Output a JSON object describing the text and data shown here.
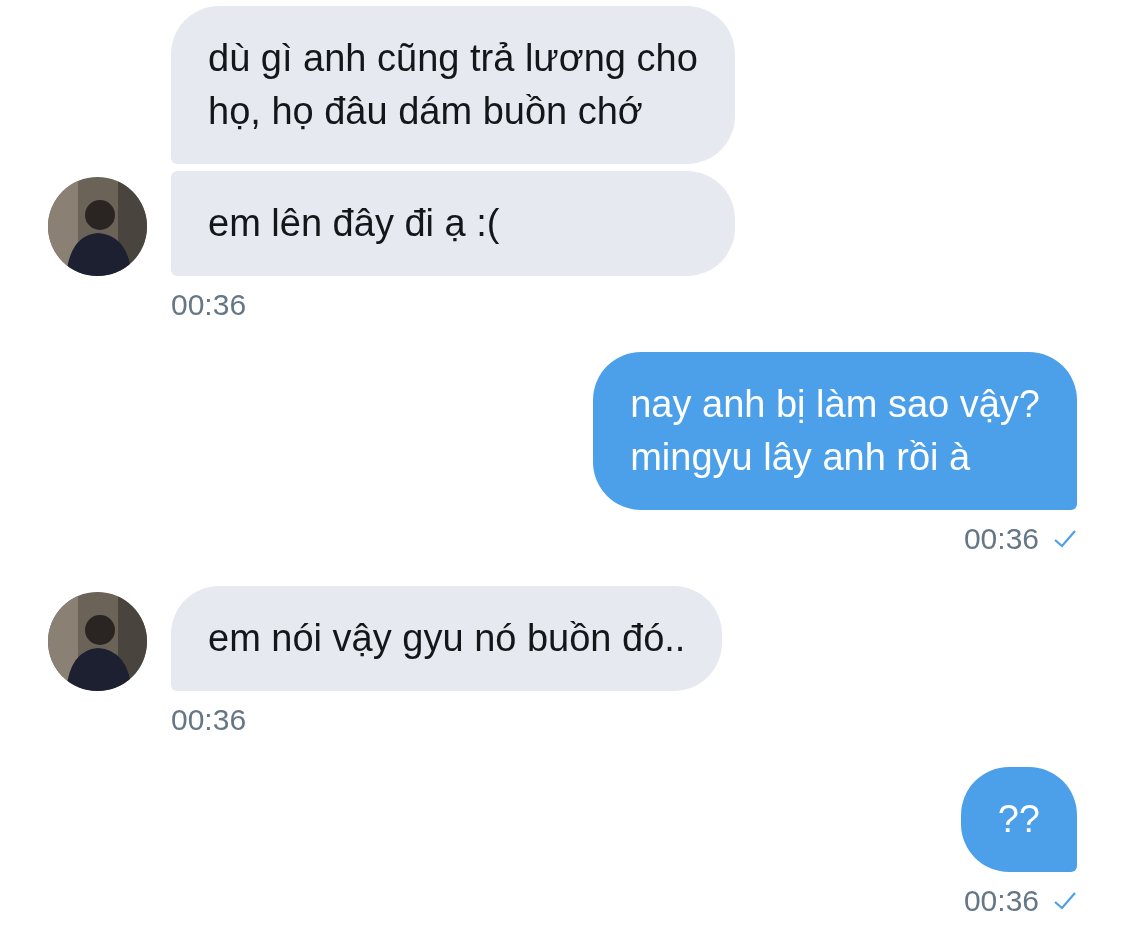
{
  "messages": [
    {
      "kind": "received",
      "bubbles": [
        "dù gì anh cũng trả lương cho\nhọ, họ đâu dám buồn chớ",
        "em lên đây đi ạ :("
      ],
      "time": "00:36"
    },
    {
      "kind": "sent",
      "bubbles": [
        "nay anh bị làm sao vậy?\nmingyu lây anh rồi à"
      ],
      "time": "00:36",
      "delivered": true
    },
    {
      "kind": "received",
      "bubbles": [
        "em nói vậy gyu nó buồn đó.."
      ],
      "time": "00:36"
    },
    {
      "kind": "sent",
      "bubbles": [
        "??"
      ],
      "time": "00:36",
      "delivered": true
    }
  ]
}
